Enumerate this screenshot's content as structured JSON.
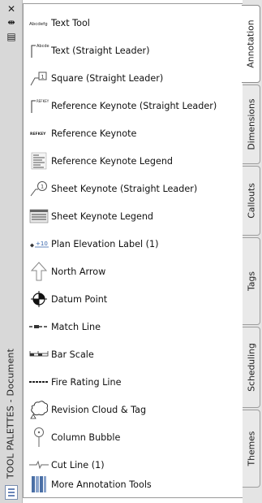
{
  "title_strip": {
    "title": "TOOL PALETTES - Document",
    "close_glyph": "✕",
    "autohide_glyph": "⇹",
    "menu_glyph": "▤",
    "close_icon": "close-icon",
    "autohide_icon": "auto-hide-icon",
    "menu_icon": "properties-menu-icon",
    "bottom_icon": "palette-properties-icon"
  },
  "tools": [
    {
      "label": "Text Tool",
      "icon": "text-tool-icon"
    },
    {
      "label": "Text (Straight Leader)",
      "icon": "text-leader-icon"
    },
    {
      "label": "Square (Straight Leader)",
      "icon": "square-leader-icon"
    },
    {
      "label": "Reference Keynote (Straight Leader)",
      "icon": "reference-keynote-leader-icon"
    },
    {
      "label": "Reference Keynote",
      "icon": "reference-keynote-icon"
    },
    {
      "label": "Reference Keynote Legend",
      "icon": "keynote-legend-icon"
    },
    {
      "label": "Sheet Keynote (Straight Leader)",
      "icon": "sheet-keynote-leader-icon"
    },
    {
      "label": "Sheet Keynote Legend",
      "icon": "sheet-keynote-legend-icon"
    },
    {
      "label": "Plan Elevation Label (1)",
      "icon": "plan-elevation-label-icon"
    },
    {
      "label": "North Arrow",
      "icon": "north-arrow-icon"
    },
    {
      "label": "Datum Point",
      "icon": "datum-point-icon"
    },
    {
      "label": "Match Line",
      "icon": "match-line-icon"
    },
    {
      "label": "Bar Scale",
      "icon": "bar-scale-icon"
    },
    {
      "label": "Fire Rating Line",
      "icon": "fire-rating-line-icon"
    },
    {
      "label": "Revision Cloud & Tag",
      "icon": "revision-cloud-icon"
    },
    {
      "label": "Column Bubble",
      "icon": "column-bubble-icon"
    },
    {
      "label": "Cut Line (1)",
      "icon": "cut-line-icon"
    },
    {
      "label": "More Annotation Tools",
      "icon": "more-tools-icon"
    }
  ],
  "icon_text": {
    "text_tool": "Abcdefg",
    "text_leader": "Abcde",
    "square_leader": "1",
    "keynote_leader": "REFKEY",
    "keynote": "REFKEY",
    "sheet_keynote": "1",
    "elevation": "+10"
  },
  "tabs": [
    {
      "label": "Annotation",
      "active": true
    },
    {
      "label": "Dimensions",
      "active": false
    },
    {
      "label": "Callouts",
      "active": false
    },
    {
      "label": "Tags",
      "active": false
    },
    {
      "label": "Scheduling",
      "active": false
    },
    {
      "label": "Themes",
      "active": false
    }
  ],
  "colors": {
    "strip_bg": "#d8d8d8",
    "tab_bg": "#e9e9e9",
    "active_tab_bg": "#ffffff",
    "icon_accent": "#2f5fa8"
  }
}
